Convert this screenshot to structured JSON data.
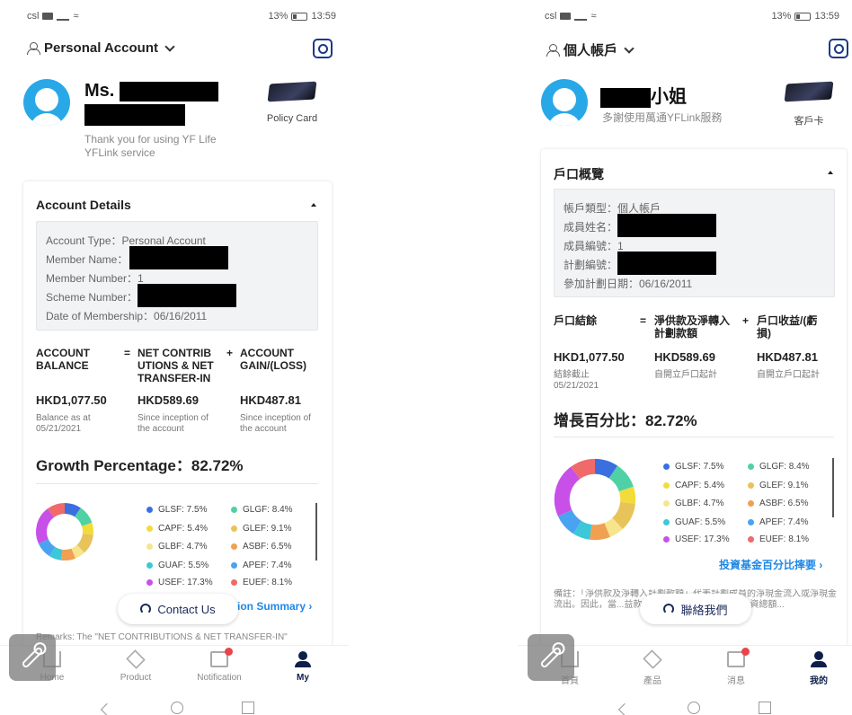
{
  "left": {
    "status": {
      "carrier": "csl",
      "battery": "13%",
      "time": "13:59"
    },
    "account_switch": "Personal Account",
    "greeting_prefix": "Ms.",
    "thanks": "Thank you for using YF Life YFLink service",
    "policy_card_label": "Policy Card",
    "panel_title": "Account Details",
    "info": {
      "account_type": "Account Type：Personal Account",
      "member_name": "Member Name：",
      "member_number": "Member Number：1",
      "scheme_number": "Scheme Number：",
      "membership_date": "Date of Membership：06/16/2011"
    },
    "balance": {
      "col1_head": "ACCOUNT BALANCE",
      "op1": "=",
      "col2_head": "NET CONTRIB UTIONS & NET TRANSFER-IN",
      "op2": "+",
      "col3_head": "ACCOUNT GAIN/(LOSS)",
      "col1_val": "HKD1,077.50",
      "col2_val": "HKD589.69",
      "col3_val": "HKD487.81",
      "col1_sub": "Balance as at 05/21/2021",
      "col2_sub": "Since inception of the account",
      "col3_sub": "Since inception of the account"
    },
    "growth": "Growth Percentage：82.72%",
    "link": "ion Summary",
    "contact": "Contact Us",
    "remarks": "Remarks: The \"NET CONTRIBUTIONS & NET TRANSFER-IN\"",
    "tabs": [
      "Home",
      "Product",
      "Notification",
      "My"
    ]
  },
  "right": {
    "status": {
      "carrier": "csl",
      "battery": "13%",
      "time": "13:59"
    },
    "account_switch": "個人帳戶",
    "greeting_suffix": "小姐",
    "thanks": "多謝使用萬通YFLink服務",
    "policy_card_label": "客戶卡",
    "panel_title": "戶口概覽",
    "info": {
      "account_type": "帳戶類型：個人帳戶",
      "member_name": "成員姓名：",
      "member_number": "成員編號：1",
      "scheme_number": "計劃編號：",
      "membership_date": "參加計劃日期：06/16/2011"
    },
    "balance": {
      "col1_head": "戶口結餘",
      "op1": "=",
      "col2_head": "淨供款及淨轉入計劃款額",
      "op2": "+",
      "col3_head": "戶口收益/(虧損)",
      "col1_val": "HKD1,077.50",
      "col2_val": "HKD589.69",
      "col3_val": "HKD487.81",
      "col1_sub": "結餘截止 05/21/2021",
      "col2_sub": "自開立戶口起計",
      "col3_sub": "自開立戶口起計"
    },
    "growth": "增長百分比：82.72%",
    "link": "投資基金百分比摔要",
    "contact": "聯絡我們",
    "remarks": "備註：「淨供款及淨轉入計劃款額」代表計劃成員的淨現金流入或淨現金流出。因此，當...益款額超過其向強積金帳戶的投資總額...",
    "tabs": [
      "首頁",
      "產品",
      "消息",
      "我的"
    ]
  },
  "funds": [
    {
      "label": "GLSF: 7.5%",
      "color": "#3b6fe0"
    },
    {
      "label": "GLGF: 8.4%",
      "color": "#4fd1a5"
    },
    {
      "label": "CAPF: 5.4%",
      "color": "#f2dc3a"
    },
    {
      "label": "GLEF: 9.1%",
      "color": "#e8c35a"
    },
    {
      "label": "GLBF: 4.7%",
      "color": "#f6e58d"
    },
    {
      "label": "ASBF: 6.5%",
      "color": "#f0a050"
    },
    {
      "label": "GUAF: 5.5%",
      "color": "#3cc8d8"
    },
    {
      "label": "APEF: 7.4%",
      "color": "#4aa3f0"
    },
    {
      "label": "USEF: 17.3%",
      "color": "#c850e8"
    },
    {
      "label": "EUEF: 8.1%",
      "color": "#f06a6a"
    }
  ],
  "chart_data": {
    "type": "pie",
    "labels": [
      "GLSF",
      "GLGF",
      "CAPF",
      "GLEF",
      "GLBF",
      "ASBF",
      "GUAF",
      "APEF",
      "USEF",
      "EUEF"
    ],
    "values": [
      7.5,
      8.4,
      5.4,
      9.1,
      4.7,
      6.5,
      5.5,
      7.4,
      17.3,
      8.1
    ],
    "title": "",
    "legend": "right"
  }
}
